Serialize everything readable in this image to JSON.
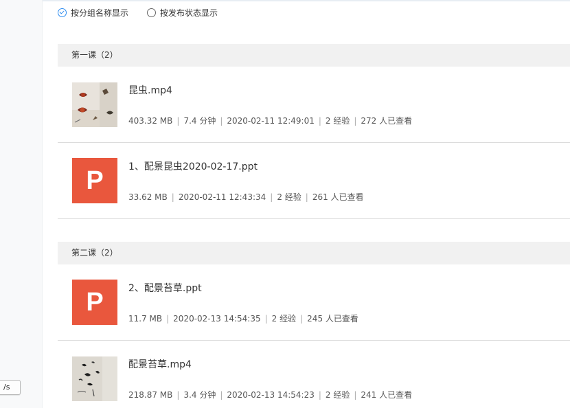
{
  "sidebar": {
    "speed_chip": "/s"
  },
  "display_mode": {
    "option_group": "按分组名称显示",
    "option_status": "按发布状态显示",
    "selected": "group"
  },
  "groups": [
    {
      "header": "第一课（2）",
      "items": [
        {
          "type": "video",
          "title": "昆虫.mp4",
          "size": "403.32 MB",
          "duration": "7.4 分钟",
          "date": "2020-02-11 12:49:01",
          "exp": "2 经验",
          "views": "272 人已查看"
        },
        {
          "type": "ppt",
          "thumb_letter": "P",
          "title": "1、配景昆虫2020-02-17.ppt",
          "size": "33.62 MB",
          "date": "2020-02-11 12:43:34",
          "exp": "2 经验",
          "views": "261 人已查看"
        }
      ]
    },
    {
      "header": "第二课（2）",
      "items": [
        {
          "type": "ppt",
          "thumb_letter": "P",
          "title": "2、配景苔草.ppt",
          "size": "11.7 MB",
          "date": "2020-02-13 14:54:35",
          "exp": "2 经验",
          "views": "245 人已查看"
        },
        {
          "type": "video",
          "title": "配景苔草.mp4",
          "size": "218.87 MB",
          "duration": "3.4 分钟",
          "date": "2020-02-13 14:54:23",
          "exp": "2 经验",
          "views": "241 人已查看"
        }
      ]
    }
  ],
  "colors": {
    "accent": "#2d8cf0",
    "ppt_tile": "#e9573d",
    "group_header_bg": "#f1f1f1"
  }
}
